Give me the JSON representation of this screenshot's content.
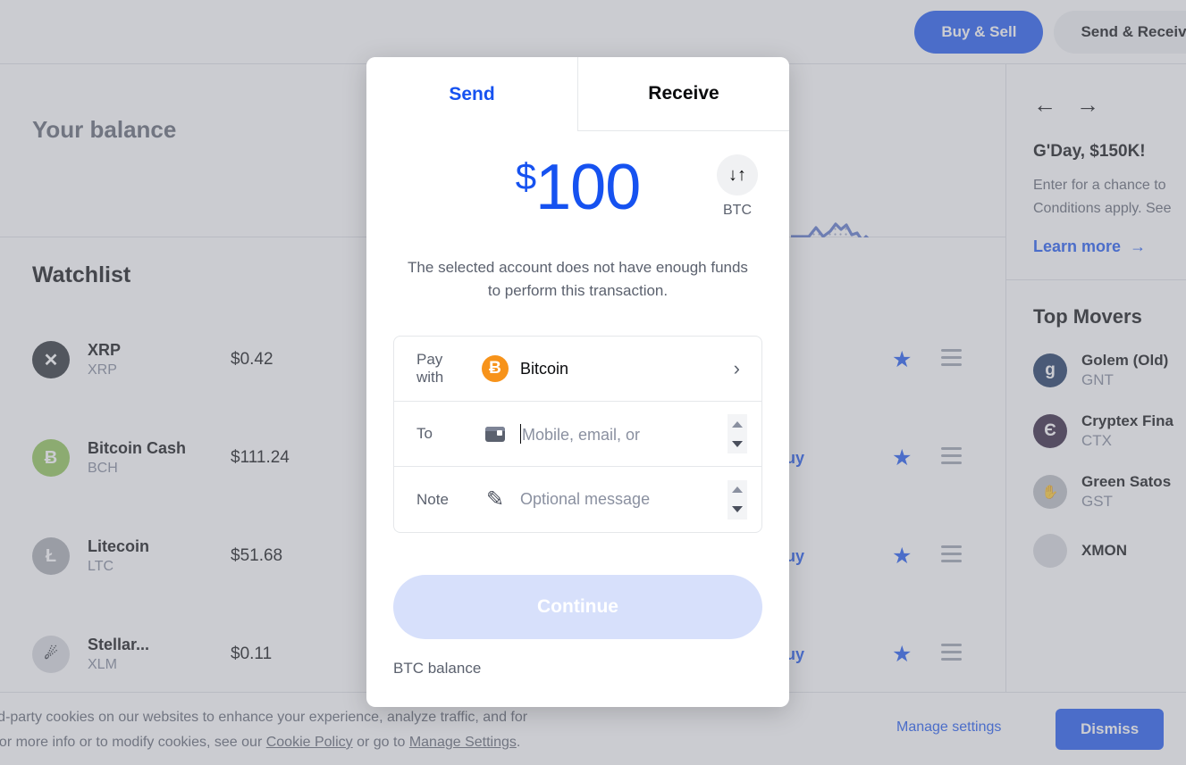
{
  "header": {
    "buy_sell_label": "Buy & Sell",
    "send_receive_label": "Send & Receive"
  },
  "balance": {
    "title": "Your balance"
  },
  "watchlist": {
    "title": "Watchlist",
    "buy_label": "Buy",
    "rows": [
      {
        "name": "XRP",
        "symbol": "XRP",
        "price": "$0.42",
        "glyph": "✕",
        "bg": "#23292f"
      },
      {
        "name": "Bitcoin Cash",
        "symbol": "BCH",
        "price": "$111.24",
        "glyph": "Ƀ",
        "bg": "#8dc351"
      },
      {
        "name": "Litecoin",
        "symbol": "LTC",
        "price": "$51.68",
        "glyph": "Ł",
        "bg": "#a6a9b0"
      },
      {
        "name": "Stellar...",
        "symbol": "XLM",
        "price": "$0.11",
        "glyph": "☄",
        "bg": "#d6d8dc"
      }
    ]
  },
  "rail": {
    "back_icon": "←",
    "forward_icon": "→",
    "promo_title": "G'Day, $150K!",
    "promo_line1": "Enter for a chance to",
    "promo_line2": "Conditions apply. See",
    "learn_more": "Learn more",
    "learn_more_arrow": "→",
    "movers_title": "Top Movers",
    "movers": [
      {
        "name": "Golem (Old)",
        "symbol": "GNT",
        "glyph": "g",
        "bg": "#14315c"
      },
      {
        "name": "Cryptex Fina",
        "symbol": "CTX",
        "glyph": "Є",
        "bg": "#2b1a38"
      },
      {
        "name": "Green Satos",
        "symbol": "GST",
        "glyph": "✋",
        "bg": "#b9bcc2"
      },
      {
        "name": "XMON",
        "symbol": "",
        "glyph": "",
        "bg": "#d6d8dc"
      }
    ]
  },
  "cookie": {
    "text_line1": "own and third-party cookies on our websites to enhance your experience, analyze traffic, and for",
    "text_line2_pre": "marketing. For more info or to modify cookies, see our ",
    "cookie_policy_link": "Cookie Policy",
    "text_line2_mid": " or go to ",
    "manage_settings_link": "Manage Settings",
    "text_line2_end": ".",
    "manage_label": "Manage settings",
    "dismiss_label": "Dismiss"
  },
  "modal": {
    "tab_send": "Send",
    "tab_receive": "Receive",
    "currency_symbol": "$",
    "amount": "100",
    "swap_icon": "↓↑",
    "swap_label": "BTC",
    "error_message": "The selected account does not have enough funds to perform this transaction.",
    "pay_with_label": "Pay with",
    "pay_with_value": "Bitcoin",
    "pay_with_icon": "Ƀ",
    "chevron_icon": "›",
    "to_label": "To",
    "to_placeholder": "Mobile, email, or",
    "note_label": "Note",
    "note_placeholder": "Optional message",
    "note_icon": "✎",
    "continue_label": "Continue",
    "btc_balance_label": "BTC balance"
  }
}
